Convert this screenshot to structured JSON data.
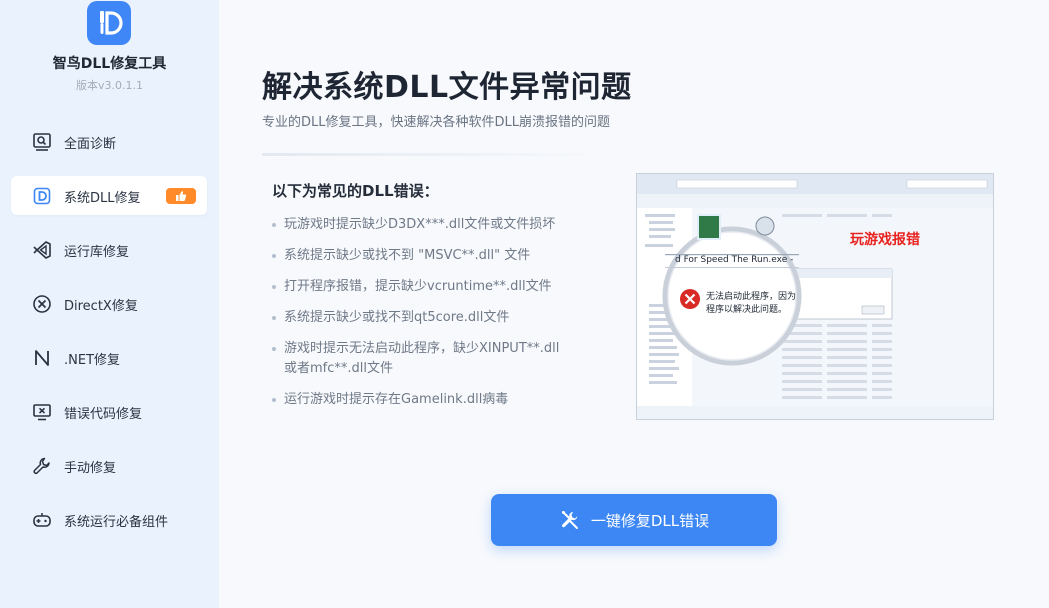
{
  "app": {
    "name": "智鸟DLL修复工具",
    "version": "版本v3.0.1.1"
  },
  "sidebar": {
    "items": [
      {
        "label": "全面诊断",
        "icon": "scan-icon"
      },
      {
        "label": "系统DLL修复",
        "icon": "dll-icon",
        "active": true
      },
      {
        "label": "运行库修复",
        "icon": "visual-studio-icon"
      },
      {
        "label": "DirectX修复",
        "icon": "directx-icon"
      },
      {
        "label": ".NET修复",
        "icon": "dotnet-icon"
      },
      {
        "label": "错误代码修复",
        "icon": "monitor-error-icon"
      },
      {
        "label": "手动修复",
        "icon": "wrench-icon"
      },
      {
        "label": "系统运行必备组件",
        "icon": "gamepad-icon"
      }
    ]
  },
  "main": {
    "title": "解决系统DLL文件异常问题",
    "subtitle": "专业的DLL修复工具，快速解决各种软件DLL崩溃报错的问题",
    "list_title": "以下为常见的DLL错误：",
    "errors": [
      "玩游戏时提示缺少D3DX***.dll文件或文件损坏",
      "系统提示缺少或找不到 \"MSVC**.dll\" 文件",
      "打开程序报错，提示缺少vcruntime**.dll文件",
      "系统提示缺少或找不到qt5core.dll文件",
      "游戏时提示无法启动此程序，缺少XINPUT**.dll或者mfc**.dll文件",
      "运行游戏时提示存在Gamelink.dll病毒"
    ],
    "illustration": {
      "caption": "玩游戏报错",
      "dialog_title": "d For Speed The Run.exe - 系统错误",
      "dialog_message_1": "无法启动此程序，因为计算机中丢",
      "dialog_message_2": "程序以解决此问题。"
    },
    "fix_button": "一键修复DLL错误"
  },
  "colors": {
    "accent": "#3d87f5",
    "sidebar_bg": "#eaf3fd",
    "badge": "#ff8a2a",
    "alert": "#e8231f"
  }
}
